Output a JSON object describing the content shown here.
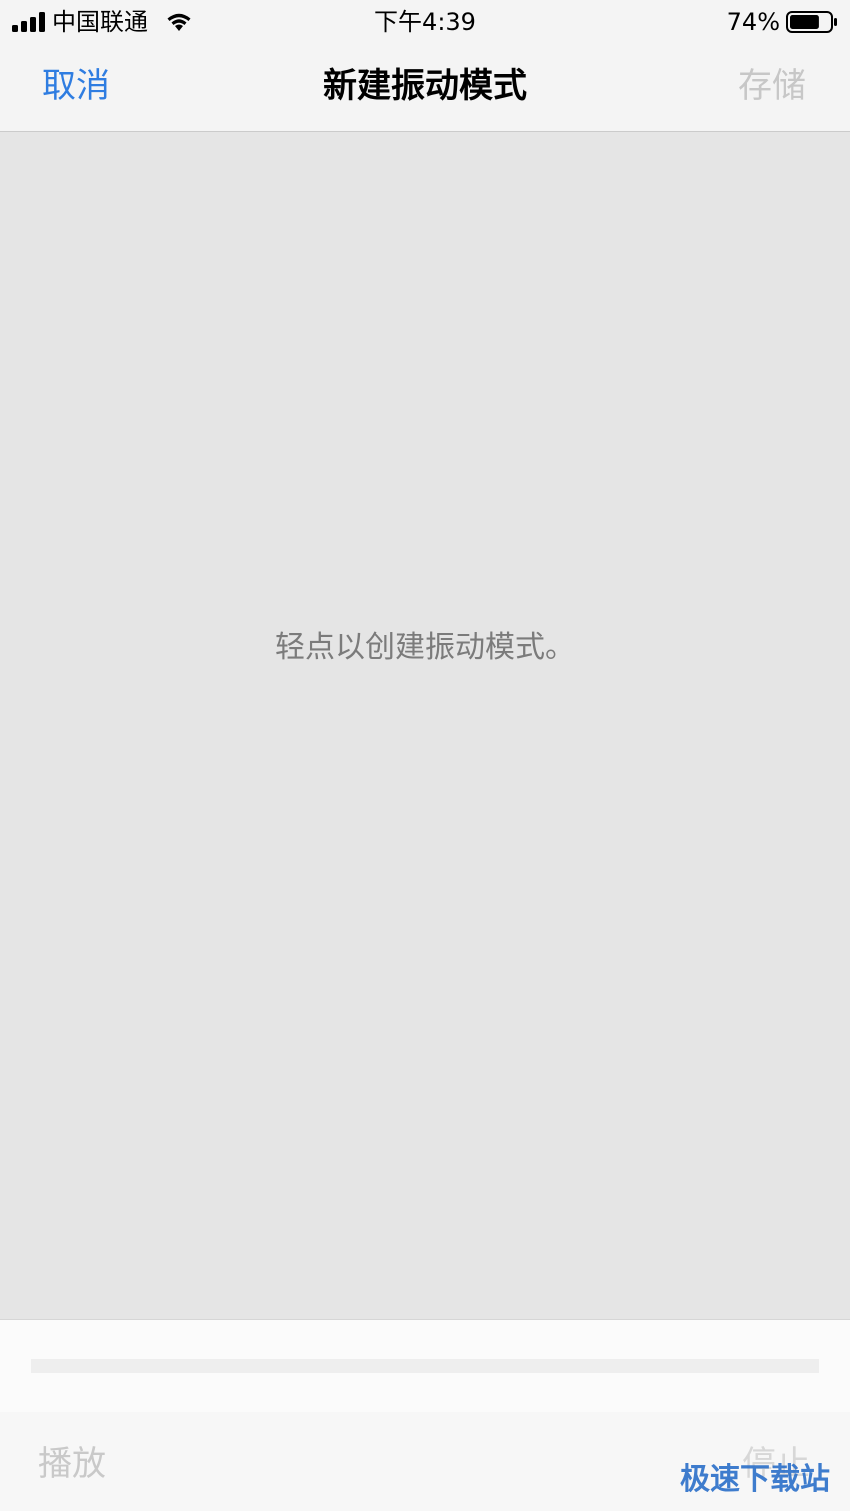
{
  "status_bar": {
    "carrier": "中国联通",
    "time": "下午4:39",
    "battery_percent": "74%",
    "icons": [
      "signal-bars-icon",
      "wifi-icon",
      "battery-icon"
    ],
    "battery_level": 0.74
  },
  "nav": {
    "cancel_label": "取消",
    "title": "新建振动模式",
    "save_label": "存储"
  },
  "canvas": {
    "hint": "轻点以创建振动模式。"
  },
  "toolbar": {
    "play_label": "播放",
    "stop_label": "停止"
  },
  "watermark": {
    "text": "极速下载站"
  },
  "colors": {
    "accent": "#2f7de1",
    "disabled": "#c7c7c7",
    "canvas_bg": "#e5e5e5",
    "watermark": "#2b6fc9"
  }
}
